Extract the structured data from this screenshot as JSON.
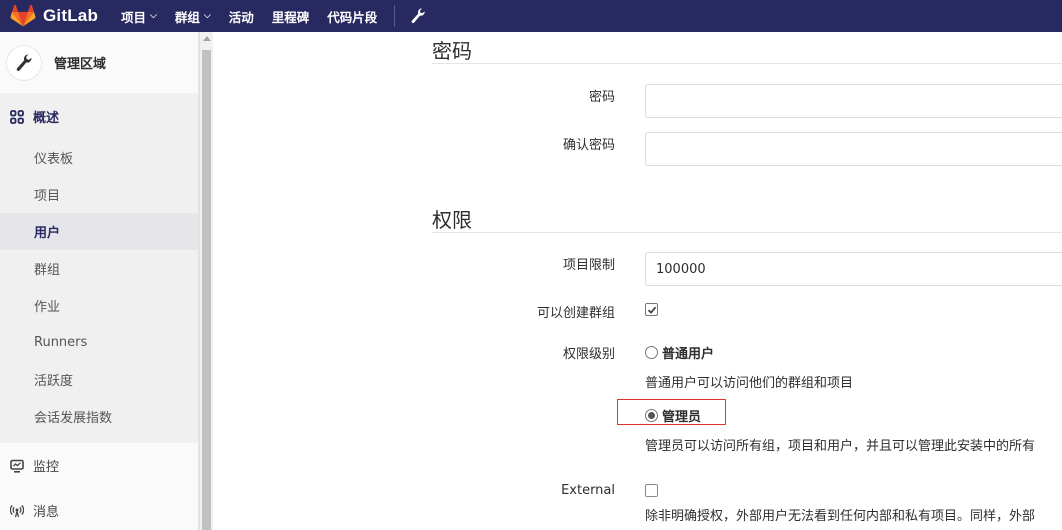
{
  "navbar": {
    "brand": "GitLab",
    "items": [
      {
        "label": "项目",
        "has_dropdown": true
      },
      {
        "label": "群组",
        "has_dropdown": true
      },
      {
        "label": "活动",
        "has_dropdown": false
      },
      {
        "label": "里程碑",
        "has_dropdown": false
      },
      {
        "label": "代码片段",
        "has_dropdown": false
      }
    ],
    "chevron": "⌄"
  },
  "sidebar": {
    "title": "管理区域",
    "overview": {
      "label": "概述",
      "items": [
        "仪表板",
        "项目",
        "用户",
        "群组",
        "作业",
        "Runners",
        "活跃度",
        "会话发展指数"
      ],
      "active_index": 2
    },
    "items": [
      {
        "label": "监控",
        "icon": "monitor-icon"
      },
      {
        "label": "消息",
        "icon": "broadcast-icon"
      }
    ]
  },
  "form": {
    "password_section": {
      "title": "密码",
      "password_label": "密码",
      "password_value": "",
      "confirm_label": "确认密码",
      "confirm_value": ""
    },
    "access_section": {
      "title": "权限",
      "projects_limit_label": "项目限制",
      "projects_limit_value": "100000",
      "can_create_group_label": "可以创建群组",
      "can_create_group_checked": true,
      "access_level_label": "权限级别",
      "regular_label": "普通用户",
      "regular_help": "普通用户可以访问他们的群组和项目",
      "admin_label": "管理员",
      "admin_help": "管理员可以访问所有组，项目和用户，并且可以管理此安装中的所有",
      "admin_selected": true,
      "external_label": "External",
      "external_checked": false,
      "external_help": "除非明确授权，外部用户无法看到任何内部和私有项目。同样，外部"
    }
  },
  "colors": {
    "navbar": "#292961",
    "highlight": "#e0322f"
  }
}
